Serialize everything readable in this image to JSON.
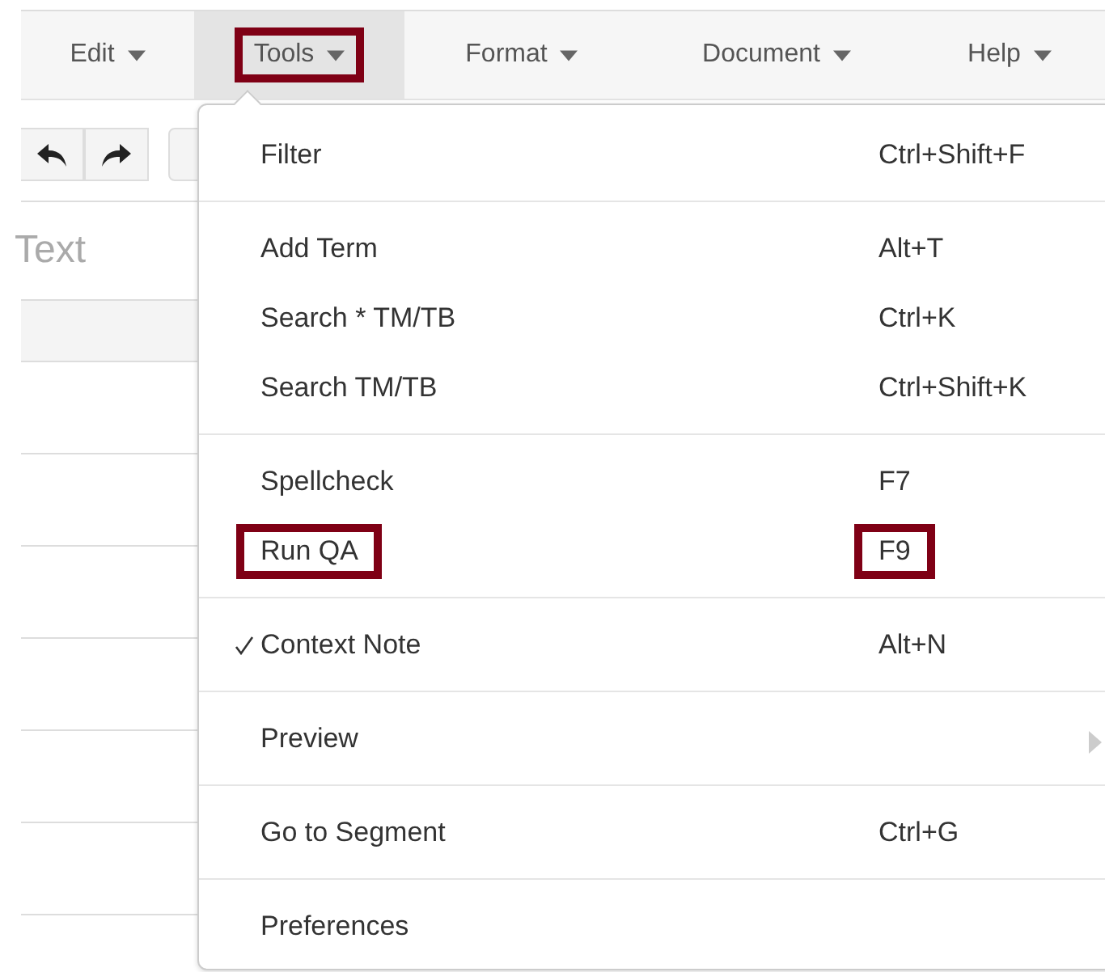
{
  "menubar": [
    {
      "label": "Edit",
      "selected": false,
      "highlighted": false
    },
    {
      "label": "Tools",
      "selected": true,
      "highlighted": true
    },
    {
      "label": "Format",
      "selected": false,
      "highlighted": false
    },
    {
      "label": "Document",
      "selected": false,
      "highlighted": false
    },
    {
      "label": "Help",
      "selected": false,
      "highlighted": false
    }
  ],
  "editor": {
    "placeholder": "Text"
  },
  "menu": {
    "sections": [
      {
        "items": [
          {
            "label": "Filter",
            "shortcut": "Ctrl+Shift+F",
            "checked": false,
            "highlighted": false,
            "shortcut_highlighted": false,
            "submenu": false
          }
        ]
      },
      {
        "items": [
          {
            "label": "Add Term",
            "shortcut": "Alt+T",
            "checked": false,
            "highlighted": false,
            "shortcut_highlighted": false,
            "submenu": false
          },
          {
            "label": "Search * TM/TB",
            "shortcut": "Ctrl+K",
            "checked": false,
            "highlighted": false,
            "shortcut_highlighted": false,
            "submenu": false
          },
          {
            "label": "Search TM/TB",
            "shortcut": "Ctrl+Shift+K",
            "checked": false,
            "highlighted": false,
            "shortcut_highlighted": false,
            "submenu": false
          }
        ]
      },
      {
        "items": [
          {
            "label": "Spellcheck",
            "shortcut": "F7",
            "checked": false,
            "highlighted": false,
            "shortcut_highlighted": false,
            "submenu": false
          },
          {
            "label": "Run QA",
            "shortcut": "F9",
            "checked": false,
            "highlighted": true,
            "shortcut_highlighted": true,
            "submenu": false
          }
        ]
      },
      {
        "items": [
          {
            "label": "Context Note",
            "shortcut": "Alt+N",
            "checked": true,
            "highlighted": false,
            "shortcut_highlighted": false,
            "submenu": false
          }
        ]
      },
      {
        "items": [
          {
            "label": "Preview",
            "checked": false,
            "highlighted": false,
            "submenu": true
          }
        ]
      },
      {
        "items": [
          {
            "label": "Go to Segment",
            "shortcut": "Ctrl+G",
            "checked": false,
            "highlighted": false,
            "shortcut_highlighted": false,
            "submenu": false
          }
        ]
      },
      {
        "items": [
          {
            "label": "Preferences",
            "checked": false,
            "highlighted": false,
            "submenu": false
          }
        ]
      }
    ]
  }
}
